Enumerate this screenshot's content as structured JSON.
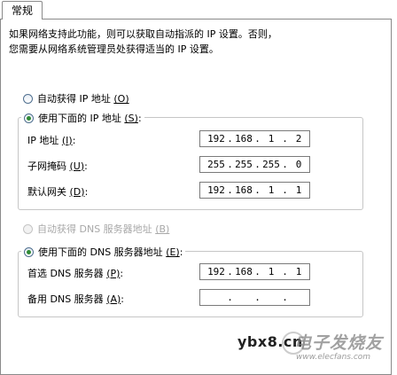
{
  "tab": {
    "label": "常规"
  },
  "description": {
    "line1": "如果网络支持此功能，则可以获取自动指派的 IP 设置。否则，",
    "line2": "您需要从网络系统管理员处获得适当的 IP 设置。"
  },
  "ip_section": {
    "auto_label": "自动获得 IP 地址",
    "auto_key": "(O)",
    "manual_label": "使用下面的 IP 地址",
    "manual_key": "(S)",
    "fields": [
      {
        "label": "IP 地址",
        "key": "(I)",
        "octets": [
          "192",
          "168",
          "1",
          "2"
        ]
      },
      {
        "label": "子网掩码",
        "key": "(U)",
        "octets": [
          "255",
          "255",
          "255",
          "0"
        ]
      },
      {
        "label": "默认网关",
        "key": "(D)",
        "octets": [
          "192",
          "168",
          "1",
          "1"
        ]
      }
    ]
  },
  "dns_section": {
    "auto_label": "自动获得 DNS 服务器地址",
    "auto_key": "(B)",
    "manual_label": "使用下面的 DNS 服务器地址",
    "manual_key": "(E)",
    "fields": [
      {
        "label": "首选 DNS 服务器",
        "key": "(P)",
        "octets": [
          "192",
          "168",
          "1",
          "1"
        ]
      },
      {
        "label": "备用 DNS 服务器",
        "key": "(A)",
        "octets": [
          "",
          "",
          "",
          ""
        ]
      }
    ]
  },
  "watermark": {
    "text": "ybx8.cn",
    "cn": "电子发烧友",
    "url": "www.elecfans.com"
  },
  "colors": {
    "radio_dot": "#2f8a35",
    "border": "#8a8a8a",
    "disabled": "#a8a8a8"
  }
}
